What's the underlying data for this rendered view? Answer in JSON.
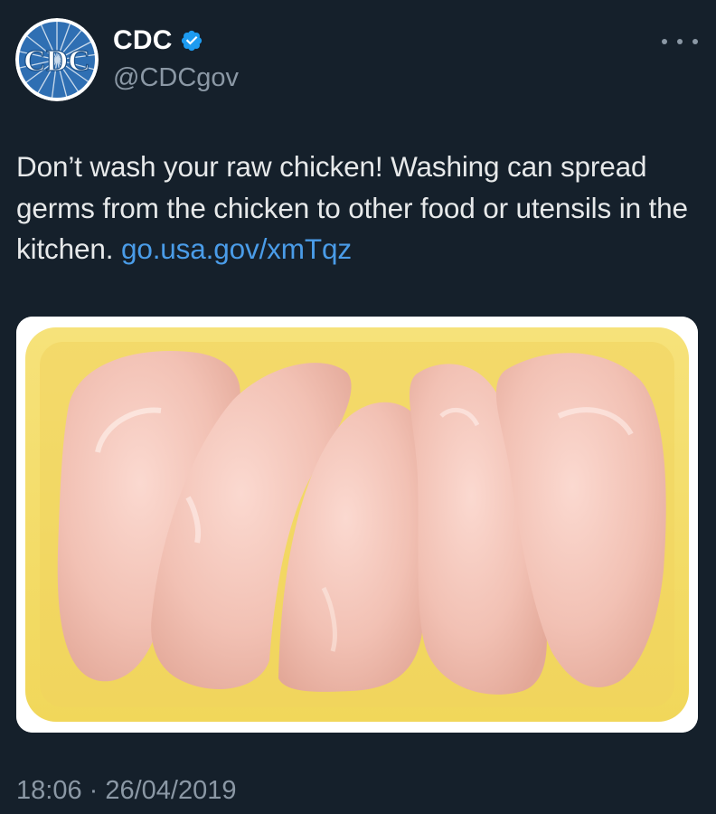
{
  "author": {
    "display_name": "CDC",
    "handle": "@CDCgov",
    "avatar_text": "CDC",
    "verified": true
  },
  "tweet": {
    "text": "Don’t wash your raw chicken! Washing can spread germs from the chicken to other food or utensils in the kitchen.",
    "link": "go.usa.gov/xmTqz",
    "timestamp": "18:06 · 26/04/2019"
  },
  "media": {
    "alt": "raw chicken breasts in a yellow foam tray"
  },
  "icons": {
    "verified": "verified-badge-icon",
    "more": "more-options-icon"
  },
  "colors": {
    "background": "#15202b",
    "text": "#e7e9ea",
    "secondary": "#8b98a5",
    "link": "#4a9ce8",
    "verified": "#1d9bf0"
  }
}
